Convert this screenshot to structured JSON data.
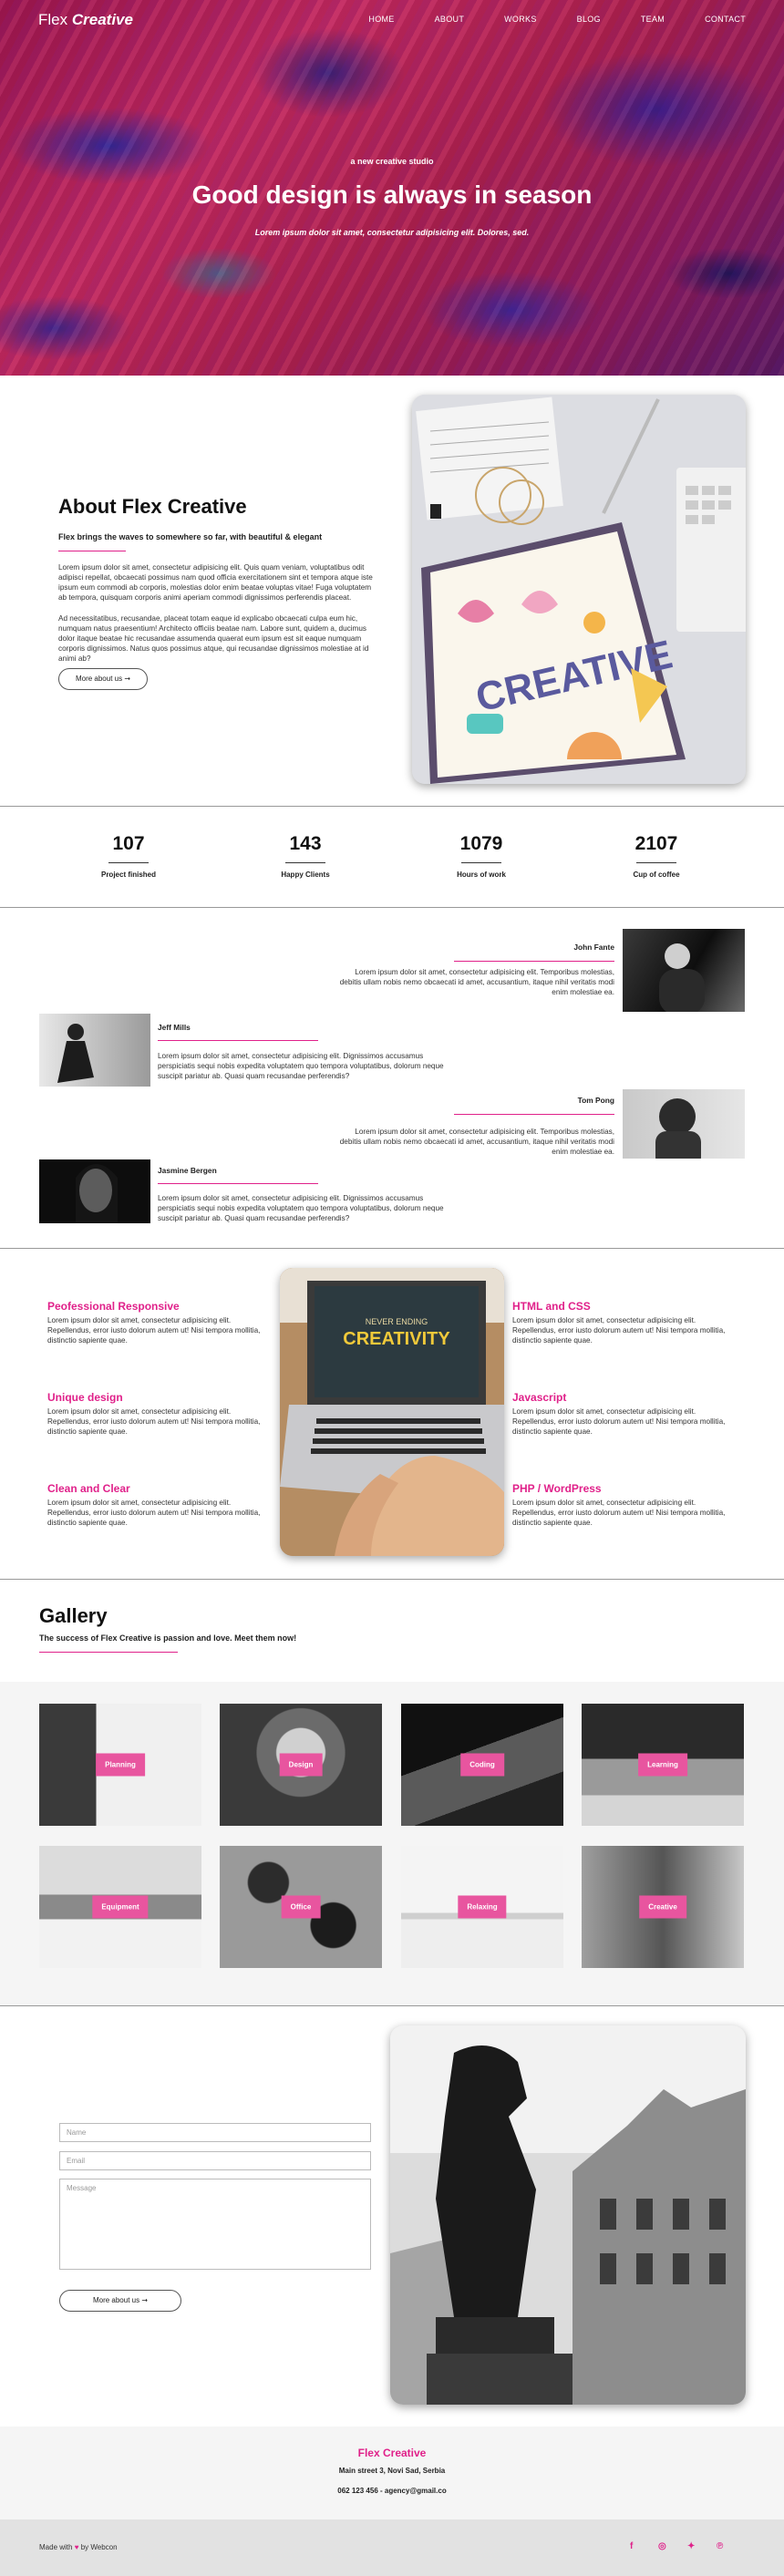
{
  "brand": {
    "plain": "Flex",
    "italic": "Creative"
  },
  "nav": [
    "HOME",
    "ABOUT",
    "WORKS",
    "BLOG",
    "TEAM",
    "CONTACT"
  ],
  "hero": {
    "kicker": "a new creative studio",
    "title": "Good design is always in season",
    "subtitle": "Lorem ipsum dolor sit amet, consectetur adipisicing elit. Dolores, sed."
  },
  "about": {
    "title": "About Flex Creative",
    "lead": "Flex brings the waves to somewhere so far, with beautiful & elegant",
    "p1": "Lorem ipsum dolor sit amet, consectetur adipisicing elit. Quis quam veniam, voluptatibus odit adipisci repellat, obcaecati possimus nam quod officia exercitationem sint et tempora atque iste ipsum eum commodi ab corporis, molestias dolor enim beatae voluptas vitae! Fuga voluptatem ab tempora, quisquam corporis animi aperiam commodi dignissimos perferendis placeat.",
    "p2": "Ad necessitatibus, recusandae, placeat totam eaque id explicabo obcaecati culpa eum hic, numquam natus praesentium! Architecto officiis beatae nam. Labore sunt, quidem a, ducimus dolor itaque beatae hic recusandae assumenda quaerat eum ipsum est sit eaque numquam corporis dignissimos. Natus quos possimus atque, qui recusandae dignissimos molestiae at id animi ab?",
    "button": "More about us ➞",
    "image_word": "CREATIVE"
  },
  "stats": [
    {
      "value": "107",
      "label": "Project finished"
    },
    {
      "value": "143",
      "label": "Happy Clients"
    },
    {
      "value": "1079",
      "label": "Hours of work"
    },
    {
      "value": "2107",
      "label": "Cup of coffee"
    }
  ],
  "team": [
    {
      "name": "John Fante",
      "text": "Lorem ipsum dolor sit amet, consectetur adipisicing elit. Temporibus molestias, debitis ullam nobis nemo obcaecati id amet, accusantium, itaque nihil veritatis modi enim molestiae ea."
    },
    {
      "name": "Jeff Mills",
      "text": "Lorem ipsum dolor sit amet, consectetur adipisicing elit. Dignissimos accusamus perspiciatis sequi nobis expedita voluptatem quo tempora voluptatibus, dolorum neque suscipit pariatur ab. Quasi quam recusandae perferendis?"
    },
    {
      "name": "Tom Pong",
      "text": "Lorem ipsum dolor sit amet, consectetur adipisicing elit. Temporibus molestias, debitis ullam nobis nemo obcaecati id amet, accusantium, itaque nihil veritatis modi enim molestiae ea."
    },
    {
      "name": "Jasmine Bergen",
      "text": "Lorem ipsum dolor sit amet, consectetur adipisicing elit. Dignissimos accusamus perspiciatis sequi nobis expedita voluptatem quo tempora voluptatibus, dolorum neque suscipit pariatur ab. Quasi quam recusandae perferendis?"
    }
  ],
  "features": {
    "text": "Lorem ipsum dolor sit amet, consectetur adipisicing elit. Repellendus, error iusto dolorum autem ut! Nisi tempora mollitia, distinctio sapiente quae.",
    "left": [
      "Peofessional Responsive",
      "Unique design",
      "Clean and Clear"
    ],
    "right": [
      "HTML and CSS",
      "Javascript",
      "PHP / WordPress"
    ],
    "laptop_line1": "NEVER ENDING",
    "laptop_line2": "CREATIVITY"
  },
  "gallery": {
    "title": "Gallery",
    "subtitle": "The success of Flex Creative is passion and love. Meet them now!",
    "items": [
      "Planning",
      "Design",
      "Coding",
      "Learning",
      "Equipment",
      "Office",
      "Relaxing",
      "Creative"
    ]
  },
  "contact": {
    "name_placeholder": "Name",
    "email_placeholder": "Email",
    "message_placeholder": "Message",
    "button": "More about us ➞"
  },
  "footer": {
    "brand": "Flex Creative",
    "address": "Main street 3, Novi Sad, Serbia",
    "contact": "062 123 456 - agency@gmail.co",
    "made_with_pre": "Made with",
    "made_with_post": "by Webcon"
  },
  "colors": {
    "accent": "#e0218a",
    "gallery_label": "#e8559f"
  },
  "social_icons": [
    "facebook-icon",
    "instagram-icon",
    "twitter-icon",
    "pinterest-icon"
  ]
}
